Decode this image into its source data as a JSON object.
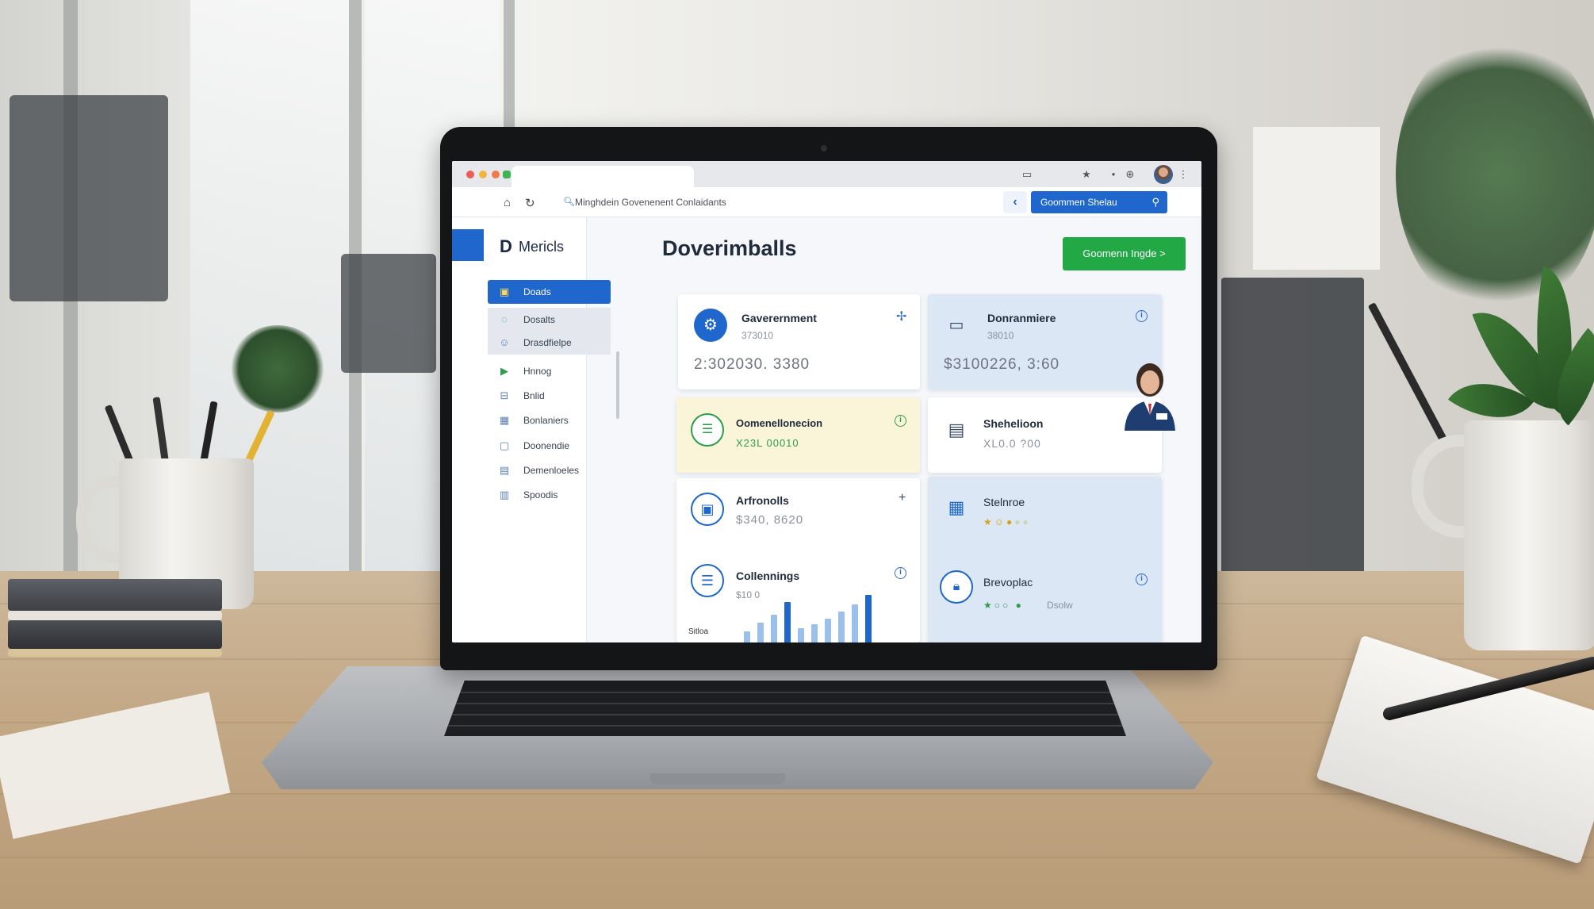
{
  "browser": {
    "url": "Minghdein Govenenent Conlaidants",
    "search_button_label": "Goommen Shelau"
  },
  "sidebar": {
    "brand_mark": "D",
    "brand_name": "Mericls",
    "items": [
      {
        "label": "Doads",
        "icon": "folder-icon",
        "active": true
      },
      {
        "label": "Dosalts",
        "icon": "chat-icon",
        "sub": true
      },
      {
        "label": "Drasdfielpe",
        "icon": "people-icon",
        "sub": true
      },
      {
        "label": "Hnnog",
        "icon": "play-icon"
      },
      {
        "label": "Bnlid",
        "icon": "inbox-icon"
      },
      {
        "label": "Bonlaniers",
        "icon": "grid-icon"
      },
      {
        "label": "Doonendie",
        "icon": "doc-icon"
      },
      {
        "label": "Demenloeles",
        "icon": "calendar-icon"
      },
      {
        "label": "Spoodis",
        "icon": "chart-icon"
      }
    ]
  },
  "main": {
    "title": "Doverimballs",
    "cta_label": "Goomenn Ingde >"
  },
  "cards": {
    "government": {
      "title": "Gaverernment",
      "sub": "373010",
      "value": "2:302030. 3380",
      "icon": "gear-icon"
    },
    "donranmiere": {
      "title": "Donranmiere",
      "sub": "38010",
      "value": "$3100226, 3:60",
      "icon": "monitor-icon"
    },
    "oomenellonecion": {
      "title": "Oomenellonecion",
      "value": "X23L 00010",
      "icon": "chat-icon"
    },
    "shehelioon": {
      "title": "Shehelioon",
      "value": "XL0.0 ?00",
      "icon": "document-icon"
    },
    "arfronolls": {
      "title": "Arfronolls",
      "value": "$340, 8620",
      "icon": "clipboard-icon"
    },
    "stelnroe": {
      "title": "Stelnroe",
      "icon": "calendar-icon",
      "rating": 3
    },
    "collennings": {
      "title": "Collennings",
      "sub": "$10 0",
      "footer": "Sitloa",
      "icon": "list-icon",
      "bars": [
        12,
        22,
        30,
        44,
        16,
        20,
        26,
        34,
        42,
        52
      ]
    },
    "brevoplac": {
      "title": "Brevoplac",
      "footer": "Dsolw",
      "icon": "lock-icon"
    }
  },
  "colors": {
    "accent_blue": "#1f67cc",
    "accent_green": "#22a845",
    "card_blue": "#dbe7f4",
    "card_yellow": "#faf4d8"
  }
}
